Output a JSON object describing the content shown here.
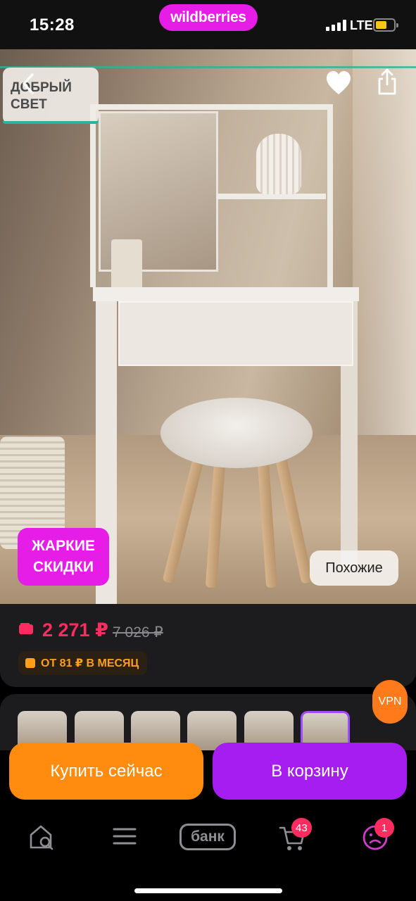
{
  "status_bar": {
    "time": "15:28",
    "brand": "wildberries",
    "network": "LTE",
    "battery_level": 0.5,
    "colors": {
      "brand": "#e61de6",
      "battery": "#f5c518"
    }
  },
  "product": {
    "seller_logo_line1": "ДОБРЫЙ",
    "seller_logo_line2": "СВЕТ",
    "promo_line1": "ЖАРКИЕ",
    "promo_line2": "СКИДКИ",
    "similar_label": "Похожие",
    "price": "2 271 ₽",
    "old_price": "7 026 ₽",
    "installment": "ОТ 81 ₽ В МЕСЯЦ",
    "colors": {
      "price": "#ff2d5f",
      "installment": "#ff9f1a",
      "promo": "#e61de6"
    }
  },
  "gallery": {
    "thumbnail_count": 6,
    "selected_index": 5
  },
  "vpn_label": "VPN",
  "actions": {
    "buy_now": "Купить сейчас",
    "add_to_cart": "В корзину",
    "colors": {
      "buy_now": "#ff8c0f",
      "add_to_cart": "#a51df0"
    }
  },
  "tab_bar": {
    "bank_label": "банк",
    "cart_badge": "43",
    "profile_badge": "1",
    "items": [
      "home-search-icon",
      "catalog-icon",
      "bank-icon",
      "cart-icon",
      "profile-icon"
    ]
  }
}
